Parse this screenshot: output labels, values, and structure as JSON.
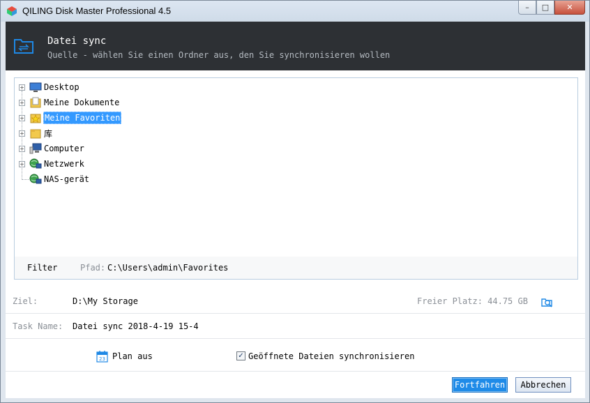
{
  "window": {
    "title": "QILING Disk Master Professional 4.5",
    "controls": {
      "minimize": "–",
      "maximize": "□",
      "close": "✕"
    }
  },
  "header": {
    "title": "Datei sync",
    "subtitle": "Quelle - wählen Sie einen Ordner aus, den Sie synchronisieren wollen",
    "icon": "sync-folder-icon"
  },
  "tree": {
    "items": [
      {
        "label": "Desktop",
        "icon": "desktop-icon",
        "expandable": true,
        "selected": false
      },
      {
        "label": "Meine Dokumente",
        "icon": "documents-folder-icon",
        "expandable": true,
        "selected": false
      },
      {
        "label": "Meine Favoriten",
        "icon": "favorites-folder-icon",
        "expandable": true,
        "selected": true
      },
      {
        "label": "库",
        "icon": "library-folder-icon",
        "expandable": true,
        "selected": false
      },
      {
        "label": "Computer",
        "icon": "computer-icon",
        "expandable": true,
        "selected": false
      },
      {
        "label": "Netzwerk",
        "icon": "network-icon",
        "expandable": true,
        "selected": false
      },
      {
        "label": "NAS-gerät",
        "icon": "nas-device-icon",
        "expandable": false,
        "selected": false
      }
    ],
    "expander_symbol": "+"
  },
  "filter": {
    "label": "Filter",
    "path_label": "Pfad:",
    "path_value": "C:\\Users\\admin\\Favorites"
  },
  "target": {
    "label": "Ziel:",
    "value": "D:\\My Storage",
    "free_space": "Freier Platz: 44.75 GB"
  },
  "task": {
    "label": "Task Name:",
    "value": "Datei sync 2018-4-19 15-4"
  },
  "options": {
    "schedule_label": "Plan aus",
    "sync_open_files_label": "Geöffnete Dateien synchronisieren",
    "sync_open_files_checked": true,
    "check_mark": "✓"
  },
  "buttons": {
    "continue": "Fortfahren",
    "cancel": "Abbrechen"
  },
  "colors": {
    "header_bg": "#2d3034",
    "selection": "#3399ff",
    "primary_button": "#1f8be8",
    "accent_icon": "#1e88e5"
  }
}
